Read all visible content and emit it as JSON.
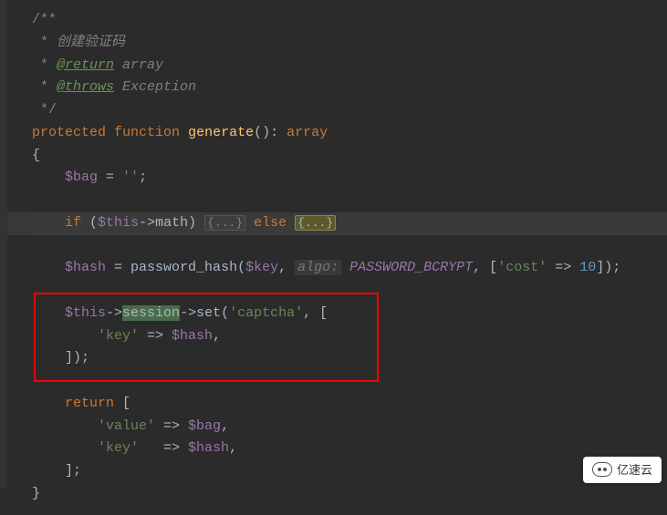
{
  "code": {
    "l1": "/**",
    "l2_star": " * ",
    "l2_text": "创建验证码",
    "l3_star": " * ",
    "l3_tag": "@return",
    "l3_text": " array",
    "l4_star": " * ",
    "l4_tag": "@throws",
    "l4_text": " Exception",
    "l5": " */",
    "l6_kw1": "protected",
    "l6_kw2": "function",
    "l6_fn": "generate",
    "l6_sig": "(): ",
    "l6_ret": "array",
    "l7": "{",
    "l8_var": "$bag",
    "l8_eq": " = ",
    "l8_str": "''",
    "l8_semi": ";",
    "l9_kw1": "if",
    "l9_open": " (",
    "l9_var": "$this",
    "l9_arrow": "->",
    "l9_prop": "math",
    "l9_close": ") ",
    "l9_fold1": "{...}",
    "l9_kw2": " else ",
    "l9_brace_open": "{",
    "l9_fold2": "...",
    "l9_brace_close": "}",
    "l10_var": "$hash",
    "l10_eq": " = ",
    "l10_fn": "password_hash",
    "l10_open": "(",
    "l10_arg1": "$key",
    "l10_comma1": ", ",
    "l10_hint": "algo:",
    "l10_const": " PASSWORD_BCRYPT",
    "l10_comma2": ", [",
    "l10_str": "'cost'",
    "l10_arrow": " => ",
    "l10_num": "10",
    "l10_close": "]);",
    "l11_var": "$this",
    "l11_arrow1": "->",
    "l11_prop": "session",
    "l11_arrow2": "->",
    "l11_method": "set",
    "l11_open": "(",
    "l11_str": "'captcha'",
    "l11_comma": ", [",
    "l12_str": "'key'",
    "l12_arrow": " => ",
    "l12_var": "$hash",
    "l12_comma": ",",
    "l13": "]);",
    "l14_kw": "return",
    "l14_open": " [",
    "l15_str": "'value'",
    "l15_arrow": " => ",
    "l15_var": "$bag",
    "l15_comma": ",",
    "l16_str": "'key'",
    "l16_arrow": "   => ",
    "l16_var": "$hash",
    "l16_comma": ",",
    "l17": "];",
    "l18": "}"
  },
  "watermark": {
    "text": "亿速云"
  }
}
